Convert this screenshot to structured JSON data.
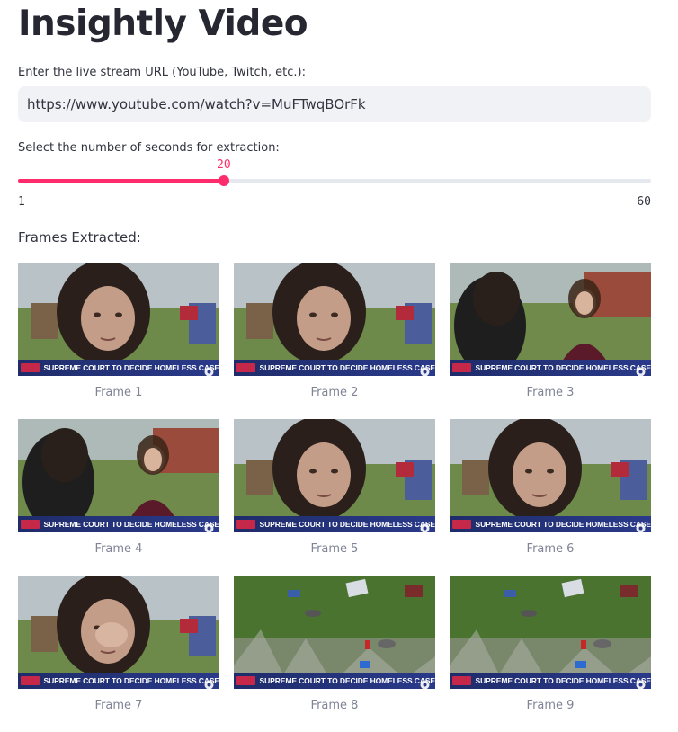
{
  "app": {
    "title": "Insightly Video"
  },
  "url_field": {
    "label": "Enter the live stream URL (YouTube, Twitch, etc.):",
    "value": "https://www.youtube.com/watch?v=MuFTwqBOrFk"
  },
  "slider": {
    "label": "Select the number of seconds for extraction:",
    "value": 20,
    "value_text": "20",
    "min": 1,
    "max": 60,
    "min_text": "1",
    "max_text": "60",
    "accent": "#ff2b6b"
  },
  "frames_section": {
    "label": "Frames Extracted:"
  },
  "frames": [
    {
      "caption": "Frame 1",
      "scene": "woman-closeup",
      "banner": "SUPREME COURT TO DECIDE HOMELESS CASE"
    },
    {
      "caption": "Frame 2",
      "scene": "woman-closeup",
      "banner": "SUPREME COURT TO DECIDE HOMELESS CASE"
    },
    {
      "caption": "Frame 3",
      "scene": "interview-wide",
      "banner": "SUPREME COURT TO DECIDE HOMELESS CASE"
    },
    {
      "caption": "Frame 4",
      "scene": "interview-wide",
      "banner": "SUPREME COURT TO DECIDE HOMELESS CASE"
    },
    {
      "caption": "Frame 5",
      "scene": "woman-closeup",
      "banner": "SUPREME COURT TO DECIDE HOMELESS CASE"
    },
    {
      "caption": "Frame 6",
      "scene": "woman-closeup",
      "banner": "SUPREME COURT TO DECIDE HOMELESS CASE"
    },
    {
      "caption": "Frame 7",
      "scene": "woman-wiping-eyes",
      "banner": "SUPREME COURT TO DECIDE HOMELESS CASE"
    },
    {
      "caption": "Frame 8",
      "scene": "aerial-encampment",
      "banner": "SUPREME COURT TO DECIDE HOMELESS CASE"
    },
    {
      "caption": "Frame 9",
      "scene": "aerial-encampment",
      "banner": "SUPREME COURT TO DECIDE HOMELESS CASE"
    }
  ]
}
